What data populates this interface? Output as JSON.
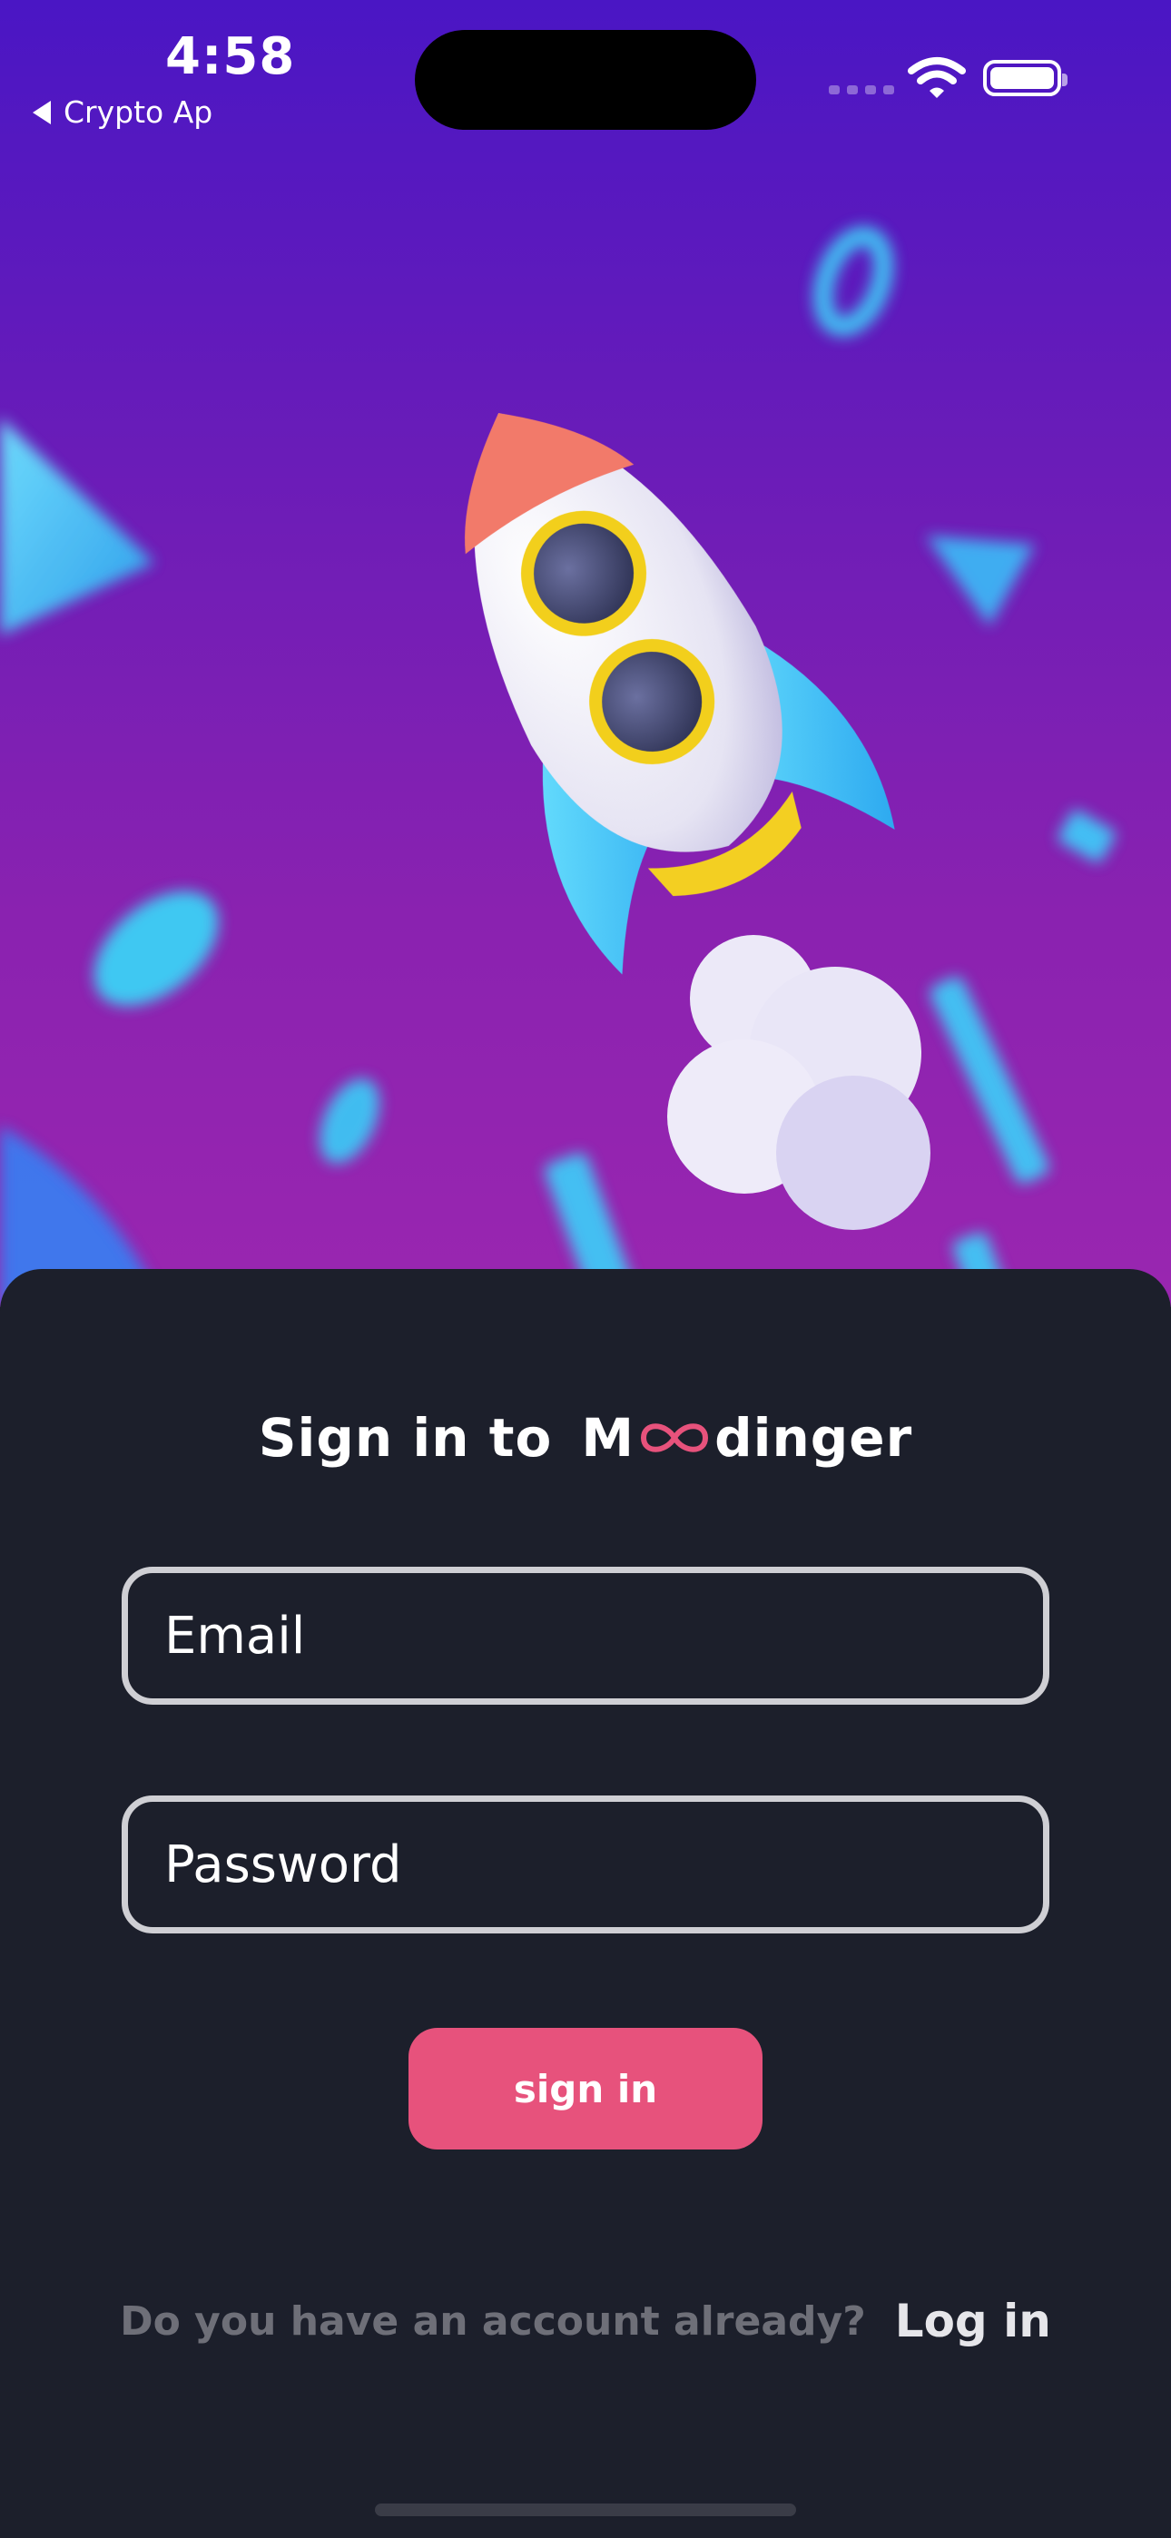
{
  "status_bar": {
    "time": "4:58",
    "back_label": "Crypto Ap",
    "icons": [
      "signal-icon",
      "wifi-icon",
      "battery-icon"
    ]
  },
  "hero": {
    "illustration": "rocket-illustration"
  },
  "signin": {
    "title_prefix": "Sign in to",
    "brand_first": "M",
    "brand_rest": "dinger",
    "email_placeholder": "Email",
    "password_placeholder": "Password",
    "button_label": "sign in",
    "footer_question": "Do you have an account already?",
    "footer_link": "Log in"
  },
  "colors": {
    "accent": "#e7527c",
    "sheet_bg": "#1c1f2b",
    "hero_top": "#4a16c4",
    "hero_bottom": "#9a26b0"
  }
}
